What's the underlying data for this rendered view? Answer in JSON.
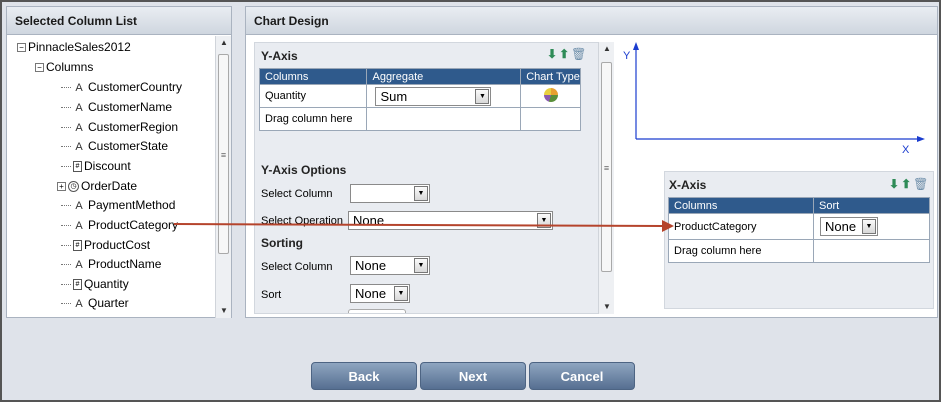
{
  "left_panel": {
    "title": "Selected Column List",
    "tree": {
      "root": "PinnacleSales2012",
      "columns_node": "Columns",
      "items": [
        {
          "label": "CustomerCountry",
          "type": "A"
        },
        {
          "label": "CustomerName",
          "type": "A"
        },
        {
          "label": "CustomerRegion",
          "type": "A"
        },
        {
          "label": "CustomerState",
          "type": "A"
        },
        {
          "label": "Discount",
          "type": "number"
        },
        {
          "label": "OrderDate",
          "type": "date"
        },
        {
          "label": "PaymentMethod",
          "type": "A"
        },
        {
          "label": "ProductCategory",
          "type": "A"
        },
        {
          "label": "ProductCost",
          "type": "number"
        },
        {
          "label": "ProductName",
          "type": "A"
        },
        {
          "label": "Quantity",
          "type": "number"
        },
        {
          "label": "Quarter",
          "type": "A"
        }
      ]
    }
  },
  "chart_design": {
    "title": "Chart Design",
    "y_axis": {
      "title": "Y-Axis",
      "headers": [
        "Columns",
        "Aggregate",
        "Chart Type"
      ],
      "rows": [
        {
          "column": "Quantity",
          "aggregate": "Sum",
          "chart_type": "pie-chart-icon"
        },
        {
          "column": "Drag column here",
          "aggregate": "",
          "chart_type": ""
        }
      ],
      "options_title": "Y-Axis Options",
      "select_column_label": "Select Column",
      "select_column_value": "",
      "select_operation_label": "Select Operation",
      "select_operation_value": "None",
      "sorting_title": "Sorting",
      "sorting_select_column_label": "Select Column",
      "sorting_select_column_value": "None",
      "sort_label": "Sort",
      "sort_value": "None"
    },
    "axis_labels": {
      "y": "Y",
      "x": "X"
    },
    "x_axis": {
      "title": "X-Axis",
      "headers": [
        "Columns",
        "Sort"
      ],
      "rows": [
        {
          "column": "ProductCategory",
          "sort": "None"
        },
        {
          "column": "Drag column here",
          "sort": ""
        }
      ]
    }
  },
  "footer": {
    "back": "Back",
    "next": "Next",
    "cancel": "Cancel"
  },
  "colors": {
    "accent": "#2f5a8c",
    "drag_arrow": "#b5442c",
    "button": "#566f91"
  },
  "icons": {
    "tree_text": "A",
    "move_down": "arrow-down-icon",
    "move_up": "arrow-up-icon",
    "delete": "trash-icon"
  }
}
